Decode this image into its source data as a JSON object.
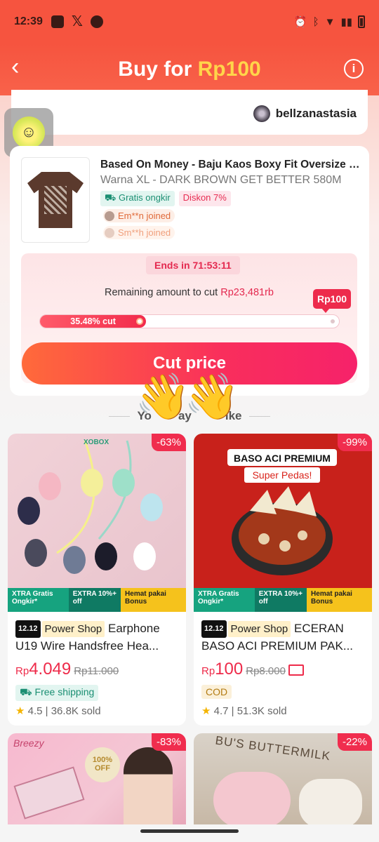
{
  "statusbar": {
    "time": "12:39",
    "icons": [
      "bri-mo-icon",
      "x-icon",
      "app-icon"
    ],
    "right_icons": [
      "alarm-icon",
      "bluetooth-icon",
      "wifi-icon",
      "signal-icon",
      "signal-icon",
      "battery-icon"
    ]
  },
  "header": {
    "title_prefix": "Buy for ",
    "title_price": "Rp100",
    "back_icon": "‹",
    "info_icon": "i"
  },
  "user": {
    "name": "bellzanastasia"
  },
  "product": {
    "title": "Based On Money - Baju Kaos Boxy Fit Oversize D...",
    "variant": "Warna XL - DARK BROWN GET BETTER 580M",
    "tags": [
      "Gratis ongkir",
      "Diskon 7%"
    ],
    "joined": [
      "Em**n joined",
      "Sm**h joined"
    ]
  },
  "cut": {
    "ends": "Ends in 71:53:11",
    "remain_label": "Remaining amount to cut ",
    "remain_amount": "Rp23,481rb",
    "target": "Rp100",
    "progress_label": "35.48% cut",
    "progress": 0.3548,
    "button": "Cut price"
  },
  "section": {
    "left": "Yo",
    "mid": "ay",
    "right": "ike"
  },
  "products": [
    {
      "discount": "-63%",
      "brand": "XOBOX",
      "badge": "12.12",
      "shop": "Power Shop",
      "title": "Earphone U19 Wire Handsfree Hea...",
      "currency": "Rp",
      "price": "4.049",
      "old_price": "Rp11.000",
      "tag": "Free shipping",
      "rating": "4.5",
      "sold": "36.8K sold",
      "banner": [
        "XTRA Gratis Ongkir*",
        "EXTRA 10%+ off",
        "Hemat pakai Bonus"
      ]
    },
    {
      "discount": "-99%",
      "img_title": "BASO ACI PREMIUM",
      "img_sub": "Super Pedas!",
      "badge": "12.12",
      "shop": "Power Shop",
      "title": "ECERAN BASO ACI PREMIUM PAK...",
      "currency": "Rp",
      "price": "100",
      "old_price": "Rp8.000",
      "tag": "COD",
      "rating": "4.7",
      "sold": "51.3K sold",
      "banner": [
        "XTRA Gratis Ongkir*",
        "EXTRA 10%+ off",
        "Hemat pakai Bonus"
      ]
    },
    {
      "discount": "-83%",
      "img_text": "Breezy",
      "img_badge": "100% OFF"
    },
    {
      "discount": "-22%",
      "img_text": "BU'S BUTTERMILK"
    }
  ]
}
